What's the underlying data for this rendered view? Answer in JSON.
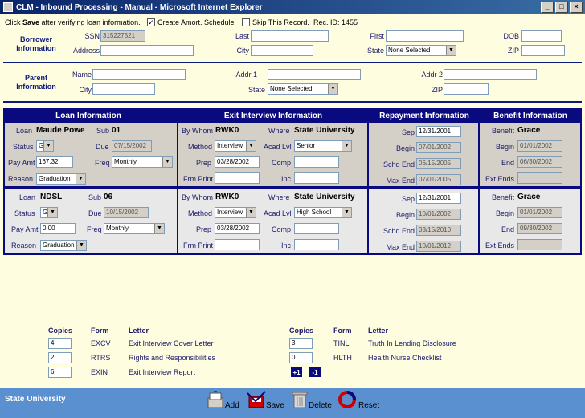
{
  "window": {
    "title": "CLM - Inbound Processing - Manual - Microsoft Internet Explorer",
    "minimize": "_",
    "maximize": "□",
    "close": "×"
  },
  "topbar": {
    "instruction_pre": "Click ",
    "instruction_bold": "Save",
    "instruction_post": " after verifying loan information.",
    "amort_label": "Create Amort. Schedule",
    "amort_checked": "✓",
    "skip_label": "Skip This Record.",
    "rec_id": "Rec. ID: 1455"
  },
  "borrower": {
    "section_label_1": "Borrower",
    "section_label_2": "Information",
    "ssn_label": "SSN",
    "ssn": "315227521",
    "last_label": "Last",
    "last": "",
    "first_label": "First",
    "first": "",
    "dob_label": "DOB",
    "dob": "",
    "address_label": "Address",
    "address": "",
    "city_label": "City",
    "city": "",
    "state_label": "State",
    "state": "None Selected",
    "zip_label": "ZIP",
    "zip": ""
  },
  "parent": {
    "section_label_1": "Parent",
    "section_label_2": "Information",
    "name_label": "Name",
    "name": "",
    "addr1_label": "Addr 1",
    "addr1": "",
    "addr2_label": "Addr 2",
    "addr2": "",
    "city_label": "City",
    "city": "",
    "state_label": "State",
    "state": "None Selected",
    "zip_label": "ZIP",
    "zip": ""
  },
  "sections": {
    "loan": "Loan Information",
    "exit": "Exit Interview Information",
    "repayment": "Repayment Information",
    "benefit": "Benefit Information"
  },
  "labels": {
    "loan": "Loan",
    "sub": "Sub",
    "status": "Status",
    "due": "Due",
    "pay_amt": "Pay Amt",
    "freq": "Freq",
    "reason": "Reason",
    "by_whom": "By Whom",
    "where": "Where",
    "method": "Method",
    "acad_lvl": "Acad Lvl",
    "prep": "Prep",
    "comp": "Comp",
    "frm_print": "Frm Print",
    "inc": "Inc",
    "sep": "Sep",
    "begin": "Begin",
    "schd_end": "Schd End",
    "max_end": "Max End",
    "benefit": "Benefit",
    "end": "End",
    "ext_ends": "Ext Ends"
  },
  "loans": [
    {
      "loan": "Maude Powe",
      "sub": "01",
      "status": "G",
      "due": "07/15/2002",
      "pay_amt": "167.32",
      "freq": "Monthly",
      "reason": "Graduation",
      "by_whom": "RWK0",
      "where": "State University",
      "method": "Interview",
      "acad_lvl": "Senior",
      "prep": "03/28/2002",
      "comp": "",
      "frm_print": "",
      "inc": "",
      "sep": "12/31/2001",
      "begin": "07/01/2002",
      "schd_end": "06/15/2005",
      "max_end": "07/01/2005",
      "benefit": "Grace",
      "benefit_begin": "01/01/2002",
      "benefit_end": "06/30/2002",
      "ext_ends": ""
    },
    {
      "loan": "NDSL",
      "sub": "06",
      "status": "G",
      "due": "10/15/2002",
      "pay_amt": "0.00",
      "freq": "Monthly",
      "reason": "Graduation",
      "by_whom": "RWK0",
      "where": "State University",
      "method": "Interview",
      "acad_lvl": "High School",
      "prep": "03/28/2002",
      "comp": "",
      "frm_print": "",
      "inc": "",
      "sep": "12/31/2001",
      "begin": "10/01/2002",
      "schd_end": "03/15/2010",
      "max_end": "10/01/2012",
      "benefit": "Grace",
      "benefit_begin": "01/01/2002",
      "benefit_end": "09/30/2002",
      "ext_ends": ""
    }
  ],
  "letters": {
    "copies_header": "Copies",
    "form_header": "Form",
    "letter_header": "Letter",
    "left": [
      {
        "copies": "4",
        "form": "EXCV",
        "letter": "Exit Interview Cover Letter"
      },
      {
        "copies": "2",
        "form": "RTRS",
        "letter": "Rights and Responsibilities"
      },
      {
        "copies": "6",
        "form": "EXIN",
        "letter": "Exit Interview Report"
      }
    ],
    "right": [
      {
        "copies": "3",
        "form": "TINL",
        "letter": "Truth In Lending Disclosure"
      },
      {
        "copies": "0",
        "form": "HLTH",
        "letter": "Health Nurse Checklist"
      }
    ],
    "plus_label": "+1",
    "minus_label": "-1"
  },
  "footer": {
    "school": "State University",
    "add": "Add",
    "save": "Save",
    "delete": "Delete",
    "reset": "Reset"
  },
  "colors": {
    "navy": "#0a0a80",
    "background": "#fffde0",
    "footer": "#5a8fd0"
  }
}
